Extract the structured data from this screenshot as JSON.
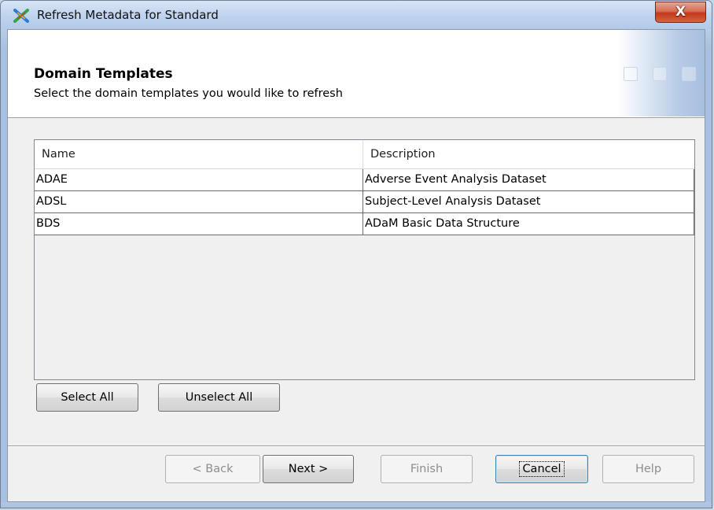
{
  "window": {
    "title": "Refresh Metadata for Standard",
    "close_label": "X"
  },
  "header": {
    "title": "Domain Templates",
    "subtitle": "Select the domain templates you would like to refresh"
  },
  "table": {
    "columns": [
      "Name",
      "Description"
    ],
    "rows": [
      {
        "name": "ADAE",
        "description": "Adverse Event Analysis Dataset"
      },
      {
        "name": "ADSL",
        "description": "Subject-Level Analysis Dataset"
      },
      {
        "name": "BDS",
        "description": "ADaM Basic Data Structure"
      }
    ]
  },
  "buttons": {
    "select_all": "Select All",
    "unselect_all": "Unselect All",
    "back": "< Back",
    "next": "Next >",
    "finish": "Finish",
    "cancel": "Cancel",
    "help": "Help"
  },
  "colors": {
    "title_bar": "#bfd3ee",
    "close_button": "#c1391d",
    "focus_border": "#3c7fb1"
  },
  "icons": {
    "app": "sas-x-icon",
    "close": "close-icon"
  }
}
